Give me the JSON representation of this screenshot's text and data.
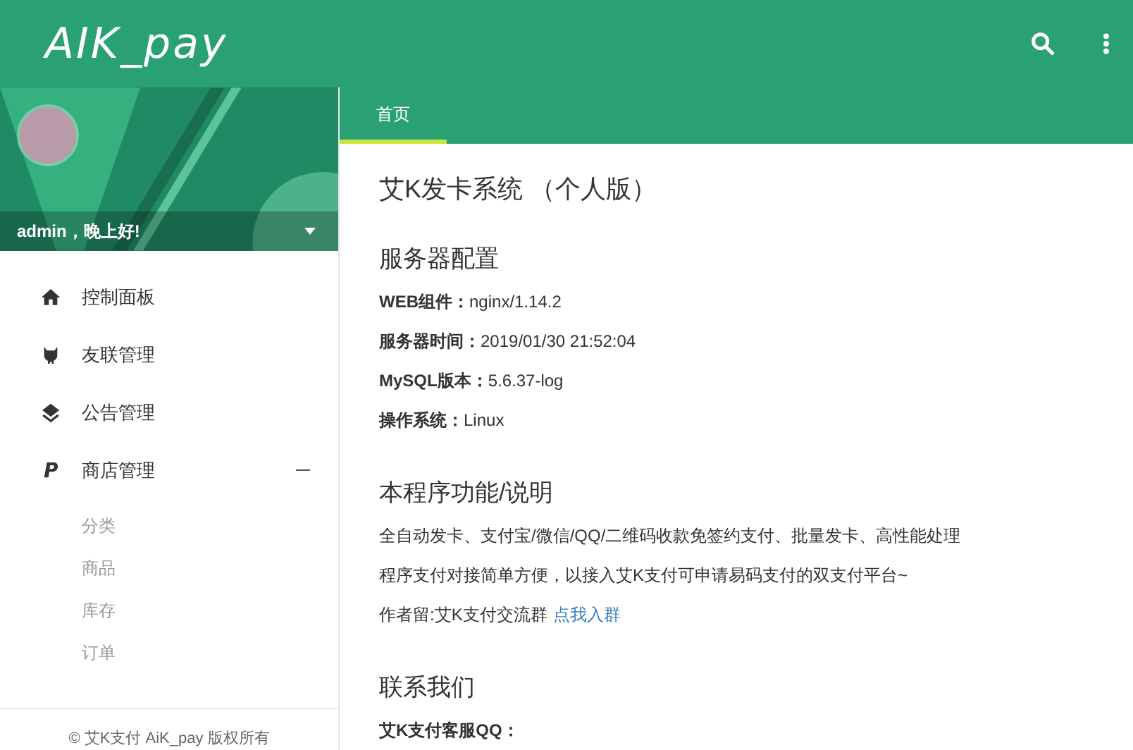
{
  "app_bar": {
    "logo": "AIK_pay"
  },
  "user": {
    "greeting": "admin，晚上好!"
  },
  "sidebar": {
    "items": [
      {
        "label": "控制面板",
        "kind": "home"
      },
      {
        "label": "友联管理",
        "kind": "cat"
      },
      {
        "label": "公告管理",
        "kind": "layers"
      },
      {
        "label": "商店管理",
        "kind": "paypal",
        "expanded": true,
        "children": [
          {
            "label": "分类"
          },
          {
            "label": "商品"
          },
          {
            "label": "库存"
          },
          {
            "label": "订单"
          }
        ]
      }
    ],
    "footer": "© 艾K支付 AiK_pay 版权所有"
  },
  "tabs": [
    {
      "label": "首页",
      "selected": true
    }
  ],
  "content": {
    "title": "艾K发卡系统 （个人版）",
    "sections": [
      {
        "heading": "服务器配置",
        "lines": [
          {
            "label": "WEB组件：",
            "value": "nginx/1.14.2"
          },
          {
            "label": "服务器时间：",
            "value": "2019/01/30 21:52:04"
          },
          {
            "label": "MySQL版本：",
            "value": "5.6.37-log"
          },
          {
            "label": "操作系统：",
            "value": "Linux"
          }
        ]
      },
      {
        "heading": "本程序功能/说明",
        "lines": [
          {
            "value": "全自动发卡、支付宝/微信/QQ/二维码收款免签约支付、批量发卡、高性能处理"
          },
          {
            "value": "程序支付对接简单方便，以接入艾K支付可申请易码支付的双支付平台~"
          },
          {
            "value": "作者留:艾K支付交流群",
            "link": "点我入群"
          }
        ]
      },
      {
        "heading": "联系我们",
        "lines": [
          {
            "label": "艾K支付客服QQ："
          }
        ]
      }
    ]
  }
}
